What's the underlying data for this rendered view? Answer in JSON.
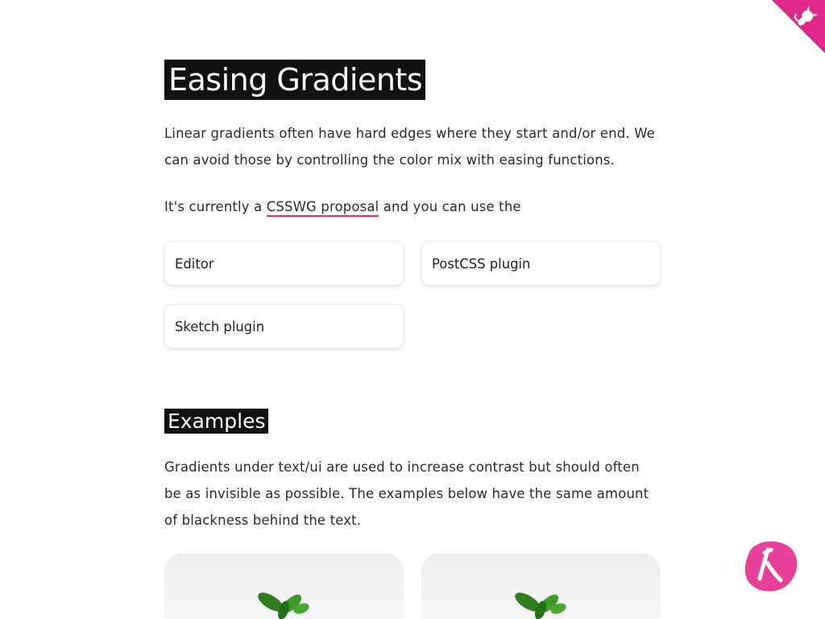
{
  "title": "Easing Gradients",
  "intro": {
    "line1": "Linear gradients often have hard edges where they start and/or end. We can avoid those by controlling the color mix with easing functions.",
    "prefix": "It's currently a ",
    "link_text": "CSSWG proposal",
    "suffix": " and you can use the"
  },
  "tools": [
    {
      "label": "Editor"
    },
    {
      "label": "PostCSS plugin"
    },
    {
      "label": "Sketch plugin"
    }
  ],
  "examples": {
    "heading": "Examples",
    "description": "Gradients under text/ui are used to increase contrast but should often be as invisible as possible. The examples below have the same amount of blackness behind the text."
  },
  "icons": {
    "github_corner": "github-octocat-icon",
    "fab": "lambda-logo-icon"
  },
  "colors": {
    "accent": "#e0288a",
    "heading_bg": "#111111"
  }
}
